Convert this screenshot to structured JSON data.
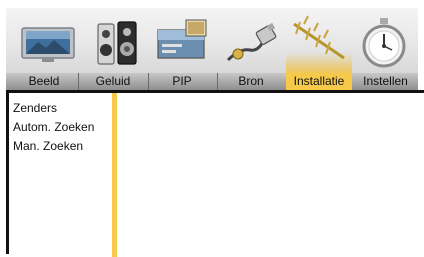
{
  "tabs": [
    {
      "label": "Beeld",
      "icon": "tv-icon"
    },
    {
      "label": "Geluid",
      "icon": "speakers-icon"
    },
    {
      "label": "PIP",
      "icon": "pip-icon"
    },
    {
      "label": "Bron",
      "icon": "cable-plug-icon"
    },
    {
      "label": "Installatie",
      "icon": "antenna-icon",
      "active": true
    },
    {
      "label": "Instellen",
      "icon": "stopwatch-icon"
    }
  ],
  "submenu": {
    "items": [
      "Zenders",
      "Autom. Zoeken",
      "Man. Zoeken"
    ]
  },
  "colors": {
    "accent": "#f6c94b",
    "tab_bar": "#9e9e9e",
    "border": "#111111"
  }
}
